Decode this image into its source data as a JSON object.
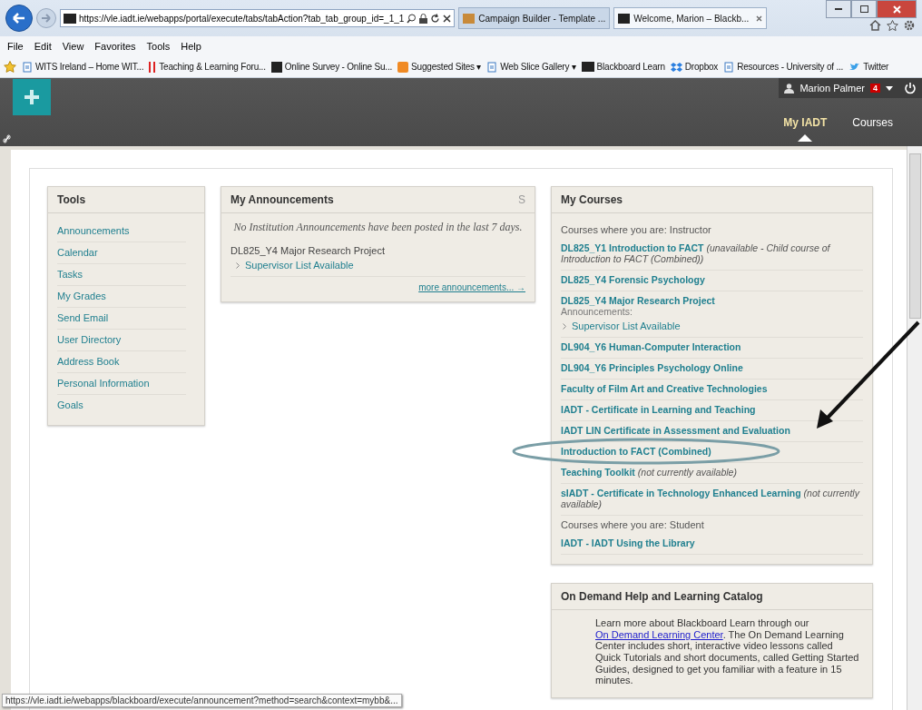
{
  "browser": {
    "address": "https://vle.iadt.ie/webapps/portal/execute/tabs/tabAction?tab_tab_group_id=_1_1",
    "tabs": [
      {
        "title": "Campaign Builder - Template ...",
        "selected": false
      },
      {
        "title": "Welcome, Marion – Blackb...",
        "selected": true
      }
    ],
    "menu": [
      "File",
      "Edit",
      "View",
      "Favorites",
      "Tools",
      "Help"
    ],
    "favorites": [
      {
        "label": "WITS Ireland – Home  WIT...",
        "kind": "page"
      },
      {
        "label": "Teaching & Learning Foru...",
        "kind": "bars"
      },
      {
        "label": "Online Survey - Online Su...",
        "kind": "sc"
      },
      {
        "label": "Suggested Sites ▾",
        "kind": "suggest"
      },
      {
        "label": "Web Slice Gallery ▾",
        "kind": "page"
      },
      {
        "label": "Blackboard Learn",
        "kind": "bb"
      },
      {
        "label": "Dropbox",
        "kind": "dropbox"
      },
      {
        "label": "Resources - University of ...",
        "kind": "page"
      },
      {
        "label": "Twitter",
        "kind": "twitter"
      }
    ]
  },
  "header": {
    "user_name": "Marion Palmer",
    "notification_count": "4",
    "tabs": [
      {
        "label": "My IADT",
        "selected": true
      },
      {
        "label": "Courses",
        "selected": false
      }
    ]
  },
  "tools": {
    "title": "Tools",
    "items": [
      "Announcements",
      "Calendar",
      "Tasks",
      "My Grades",
      "Send Email",
      "User Directory",
      "Address Book",
      "Personal Information",
      "Goals"
    ]
  },
  "announcements": {
    "title": "My Announcements",
    "corner_mark": "S",
    "notice": "No Institution Announcements have been posted in the last 7 days.",
    "course": "DL825_Y4 Major Research Project",
    "items": [
      "Supervisor List Available"
    ],
    "more_link": "more announcements... →"
  },
  "courses": {
    "title": "My Courses",
    "items": [
      {
        "kind": "role",
        "text": "Courses where you are: Instructor"
      },
      {
        "kind": "course",
        "title": "DL825_Y1 Introduction to FACT",
        "note": "(unavailable - Child course of Introduction to FACT (Combined))"
      },
      {
        "kind": "course",
        "title": "DL825_Y4 Forensic Psychology"
      },
      {
        "kind": "course",
        "title": "DL825_Y4 Major Research Project",
        "announcements_label": "Announcements:",
        "announcements": [
          "Supervisor List Available"
        ]
      },
      {
        "kind": "course",
        "title": "DL904_Y6 Human-Computer Interaction"
      },
      {
        "kind": "course",
        "title": "DL904_Y6 Principles Psychology Online"
      },
      {
        "kind": "course",
        "title": "Faculty of Film Art and Creative Technologies"
      },
      {
        "kind": "course",
        "title": "IADT - Certificate in Learning and Teaching"
      },
      {
        "kind": "course",
        "title": "IADT LIN Certificate in Assessment and Evaluation"
      },
      {
        "kind": "course",
        "title": "Introduction to FACT (Combined)"
      },
      {
        "kind": "course",
        "title": "Teaching Toolkit",
        "note": "(not currently available)"
      },
      {
        "kind": "course",
        "title": "sIADT - Certificate in Technology Enhanced Learning",
        "note": "(not currently available)"
      },
      {
        "kind": "role",
        "text": "Courses where you are: Student"
      },
      {
        "kind": "course",
        "title": "IADT - IADT Using the Library"
      }
    ]
  },
  "help": {
    "title": "On Demand Help and Learning Catalog",
    "text_before": "Learn more about Blackboard Learn through our",
    "link": "On Demand Learning Center",
    "text_after": ". The On Demand Learning Center includes short, interactive video lessons called Quick Tutorials and short documents, called Getting Started Guides, designed to get you familiar with a feature in 15 minutes."
  },
  "status_url": "https://vle.iadt.ie/webapps/blackboard/execute/announcement?method=search&context=mybb&..."
}
